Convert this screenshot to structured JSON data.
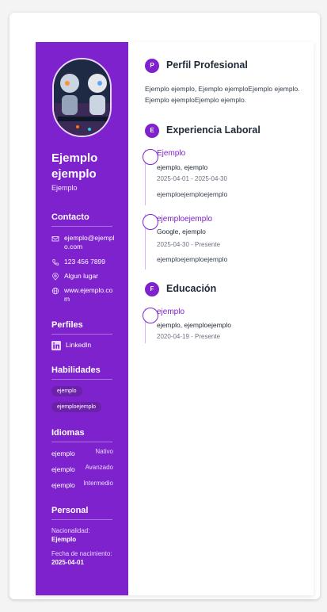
{
  "profile": {
    "name": "Ejemplo ejemplo",
    "subtitle": "Ejemplo"
  },
  "contact": {
    "heading": "Contacto",
    "email": "ejemplo@ejemplo.com",
    "phone": "123 456 7899",
    "location": "Algun lugar",
    "website": "www.ejemplo.com"
  },
  "profiles": {
    "heading": "Perfiles",
    "items": [
      {
        "label": "LinkedIn",
        "icon": "linkedin-icon"
      }
    ]
  },
  "skills": {
    "heading": "Habilidades",
    "items": [
      "ejemplo",
      "ejemploejemplo"
    ]
  },
  "languages": {
    "heading": "Idiomas",
    "items": [
      {
        "name": "ejemplo",
        "level": "Nativo"
      },
      {
        "name": "ejemplo",
        "level": "Avanzado"
      },
      {
        "name": "ejemplo",
        "level": "Intermedio"
      }
    ]
  },
  "personal": {
    "heading": "Personal",
    "nationality_label": "Nacionalidad:",
    "nationality_value": "Ejemplo",
    "birth_label": "Fecha de nacimiento:",
    "birth_value": "2025-04-01"
  },
  "summary": {
    "badge": "P",
    "heading": "Perfil Profesional",
    "text": "Ejemplo ejemplo, Ejemplo ejemploEjemplo ejemplo. Ejemplo ejemploEjemplo ejemplo."
  },
  "experience": {
    "badge": "E",
    "heading": "Experiencia Laboral",
    "items": [
      {
        "title": "Ejemplo",
        "company": "ejemplo, ejemplo",
        "dates": "2025-04-01 - 2025-04-30",
        "description": "ejemploejemploejemplo"
      },
      {
        "title": "ejemploejemplo",
        "company": "Google, ejemplo",
        "dates": "2025-04-30 - Presente",
        "description": "ejemploejemploejemplo"
      }
    ]
  },
  "education": {
    "badge": "F",
    "heading": "Educación",
    "items": [
      {
        "title": "ejemplo",
        "institution": "ejemplo, ejemploejemplo",
        "dates": "2020-04-19 - Presente"
      }
    ]
  },
  "colors": {
    "accent": "#7e22ce",
    "sidebar_bg": "#7e22ce",
    "chip_bg": "#6b21a8"
  }
}
